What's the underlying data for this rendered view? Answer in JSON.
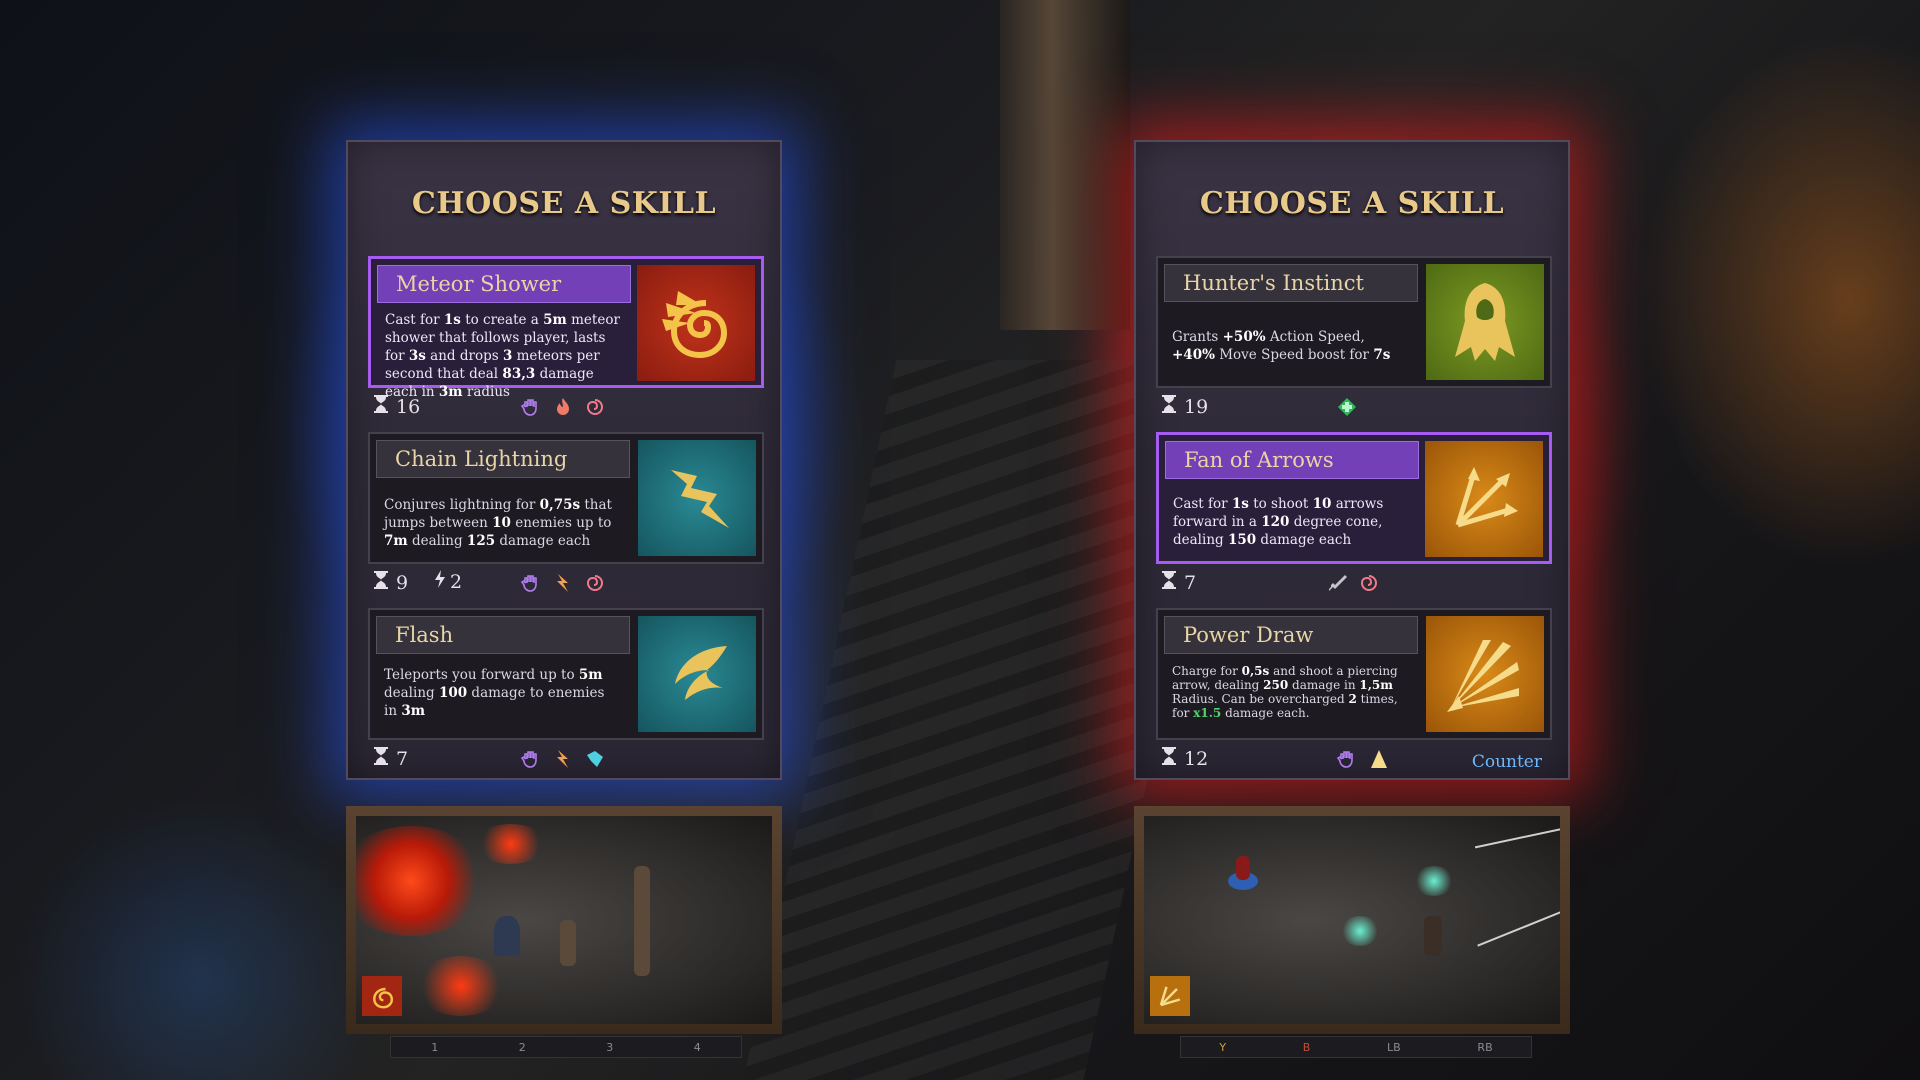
{
  "left_panel": {
    "title": "CHOOSE A SKILL",
    "skills": [
      {
        "name": "Meteor Shower",
        "icon": "meteor-icon",
        "desc_parts": [
          "Cast for ",
          "1s",
          " to create a ",
          "5m",
          " meteor shower that follows player, lasts for ",
          "3s",
          " and drops ",
          "3",
          " meteors per second that deal ",
          "83,3",
          " damage each in ",
          "3m",
          " radius"
        ],
        "cooldown": "16",
        "tags": [
          "hand-icon",
          "fire-icon",
          "spiral-icon"
        ]
      },
      {
        "name": "Chain Lightning",
        "icon": "lightning-trident-icon",
        "desc_parts": [
          "Conjures lightning for ",
          "0,75s",
          " that jumps between ",
          "10",
          " enemies up to ",
          "7m",
          " dealing ",
          "125",
          " damage each"
        ],
        "cooldown": "9",
        "charges": "2",
        "tags": [
          "hand-icon",
          "lightning-icon",
          "spiral-icon"
        ]
      },
      {
        "name": "Flash",
        "icon": "flash-wing-icon",
        "desc_parts": [
          "Teleports you forward up to ",
          "5m",
          " dealing ",
          "100",
          " damage to enemies in ",
          "3m"
        ],
        "cooldown": "7",
        "tags": [
          "hand-icon",
          "lightning-icon",
          "dash-icon"
        ]
      }
    ]
  },
  "right_panel": {
    "title": "CHOOSE A SKILL",
    "skills": [
      {
        "name": "Hunter's Instinct",
        "icon": "hooded-hunter-icon",
        "desc_parts": [
          "Grants ",
          "+50%",
          " Action Speed, ",
          "+40%",
          " Move Speed boost for ",
          "7s"
        ],
        "cooldown": "19",
        "tags": [
          "green-cross-icon"
        ]
      },
      {
        "name": "Fan of Arrows",
        "icon": "arrow-fan-icon",
        "desc_parts": [
          "Cast for ",
          "1s",
          " to shoot ",
          "10",
          " arrows forward in a ",
          "120",
          " degree cone, dealing ",
          "150",
          " damage each"
        ],
        "cooldown": "7",
        "tags": [
          "dagger-icon",
          "spiral-icon"
        ]
      },
      {
        "name": "Power Draw",
        "icon": "power-draw-icon",
        "desc_parts": [
          "Charge for ",
          "0,5s",
          " and shoot a piercing arrow, dealing ",
          "250",
          " damage in ",
          "1,5m",
          " Radius. Can be overcharged ",
          "2",
          " times, for ",
          "x1.5",
          " damage each."
        ],
        "cooldown": "12",
        "tags": [
          "hand-icon",
          "cone-icon"
        ],
        "counter_label": "Counter"
      }
    ]
  },
  "left_keys": [
    "1",
    "2",
    "3",
    "4"
  ],
  "right_keys": [
    "Y",
    "B",
    "LB",
    "RB"
  ],
  "colors": {
    "title_gold": "#e8c98a",
    "selected_border": "#a65cf0",
    "left_glow": "#2858ff",
    "right_glow": "#ff1e1e",
    "counter_blue": "#6db8ff",
    "highlight_green": "#4fd36a"
  }
}
